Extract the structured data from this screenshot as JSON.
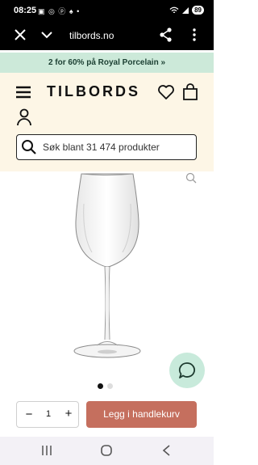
{
  "status_bar": {
    "time": "08:25",
    "left_icons": "▣ ◎ ⓟ ♠ •",
    "battery": "89"
  },
  "browser": {
    "url": "tilbords.no"
  },
  "promo": {
    "text": "2 for 60% på Royal Porcelain »"
  },
  "header": {
    "logo": "TILBORDS",
    "search_placeholder": "Søk blant 31 474 produkter"
  },
  "gallery": {
    "dot_count": 2,
    "active_index": 0
  },
  "purchase": {
    "quantity": "1",
    "minus_label": "−",
    "plus_label": "+",
    "add_to_cart_label": "Legg i handlekurv"
  },
  "colors": {
    "promo_bg": "#cce9d9",
    "header_bg": "#fdf6e6",
    "cart_button": "#c56f5e",
    "chat_bubble": "#c8eadb"
  }
}
